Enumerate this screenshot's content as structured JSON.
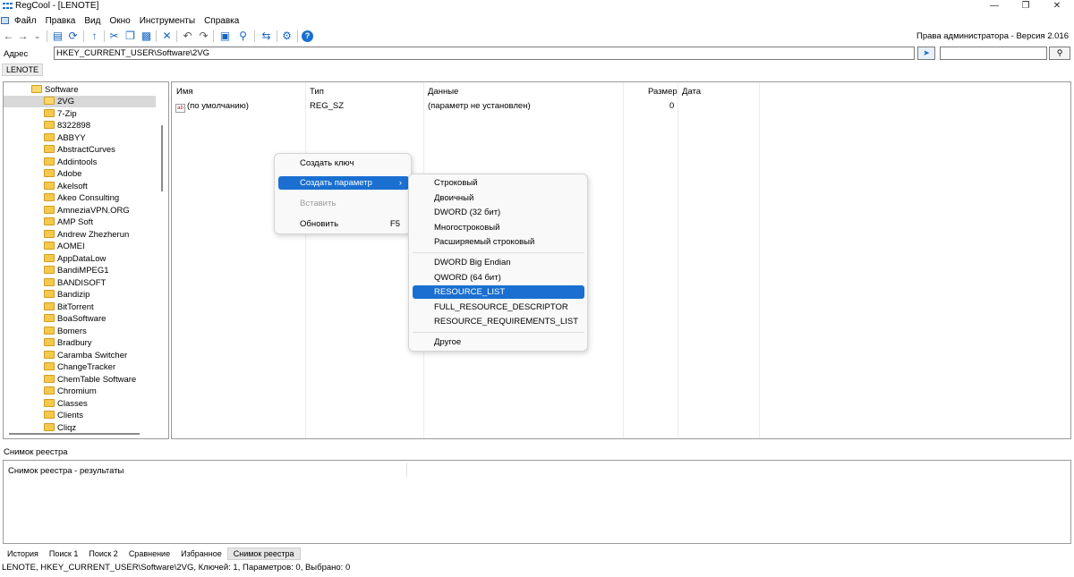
{
  "window": {
    "title": "RegCool - [LENOTE]",
    "controls": [
      "—",
      "❐",
      "✕"
    ]
  },
  "menu": {
    "items": [
      "Файл",
      "Правка",
      "Вид",
      "Окно",
      "Инструменты",
      "Справка"
    ]
  },
  "toolbar": {
    "admin_text": "Права администратора - Версия 2.016"
  },
  "address": {
    "label": "Адрес",
    "value": "HKEY_CURRENT_USER\\Software\\2VG"
  },
  "host_tab": "LENOTE",
  "tree": {
    "root": "Software",
    "selected": "2VG",
    "items": [
      "2VG",
      "7-Zip",
      "8322898",
      "ABBYY",
      "AbstractCurves",
      "Addintools",
      "Adobe",
      "Akelsoft",
      "Akeo Consulting",
      "AmneziaVPN.ORG",
      "AMP Soft",
      "Andrew Zhezherun",
      "AOMEI",
      "AppDataLow",
      "BandiMPEG1",
      "BANDISOFT",
      "Bandizip",
      "BitTorrent",
      "BoaSoftware",
      "Bomers",
      "Bradbury",
      "Caramba Switcher",
      "ChangeTracker",
      "ChemTable Software",
      "Chromium",
      "Classes",
      "Clients",
      "Cliqz"
    ]
  },
  "list": {
    "columns": [
      "Имя",
      "Тип",
      "Данные",
      "Размер",
      "Дата"
    ],
    "rows": [
      {
        "name": "(по умолчанию)",
        "type": "REG_SZ",
        "data": "(параметр не установлен)",
        "size": "0",
        "date": ""
      }
    ]
  },
  "context_menu": {
    "items": [
      {
        "label": "Создать ключ",
        "shortcut": ""
      },
      {
        "label": "Создать параметр",
        "shortcut": "›"
      },
      {
        "label": "Вставить",
        "shortcut": ""
      },
      {
        "label": "Обновить",
        "shortcut": "F5"
      }
    ]
  },
  "submenu": {
    "items": [
      "Строковый",
      "Двоичный",
      "DWORD (32 бит)",
      "Многостроковый",
      "Расширяемый строковый",
      "DWORD Big Endian",
      "QWORD (64 бит)",
      "RESOURCE_LIST",
      "FULL_RESOURCE_DESCRIPTOR",
      "RESOURCE_REQUIREMENTS_LIST",
      "Другое"
    ],
    "highlighted": "RESOURCE_LIST"
  },
  "snapshot": {
    "label": "Снимок реестра",
    "results_header": "Снимок реестра - результаты"
  },
  "bottom_tabs": [
    "История",
    "Поиск 1",
    "Поиск 2",
    "Сравнение",
    "Избранное",
    "Снимок реестра"
  ],
  "status": "LENOTE, HKEY_CURRENT_USER\\Software\\2VG, Ключей: 1, Параметров: 0, Выбрано: 0"
}
